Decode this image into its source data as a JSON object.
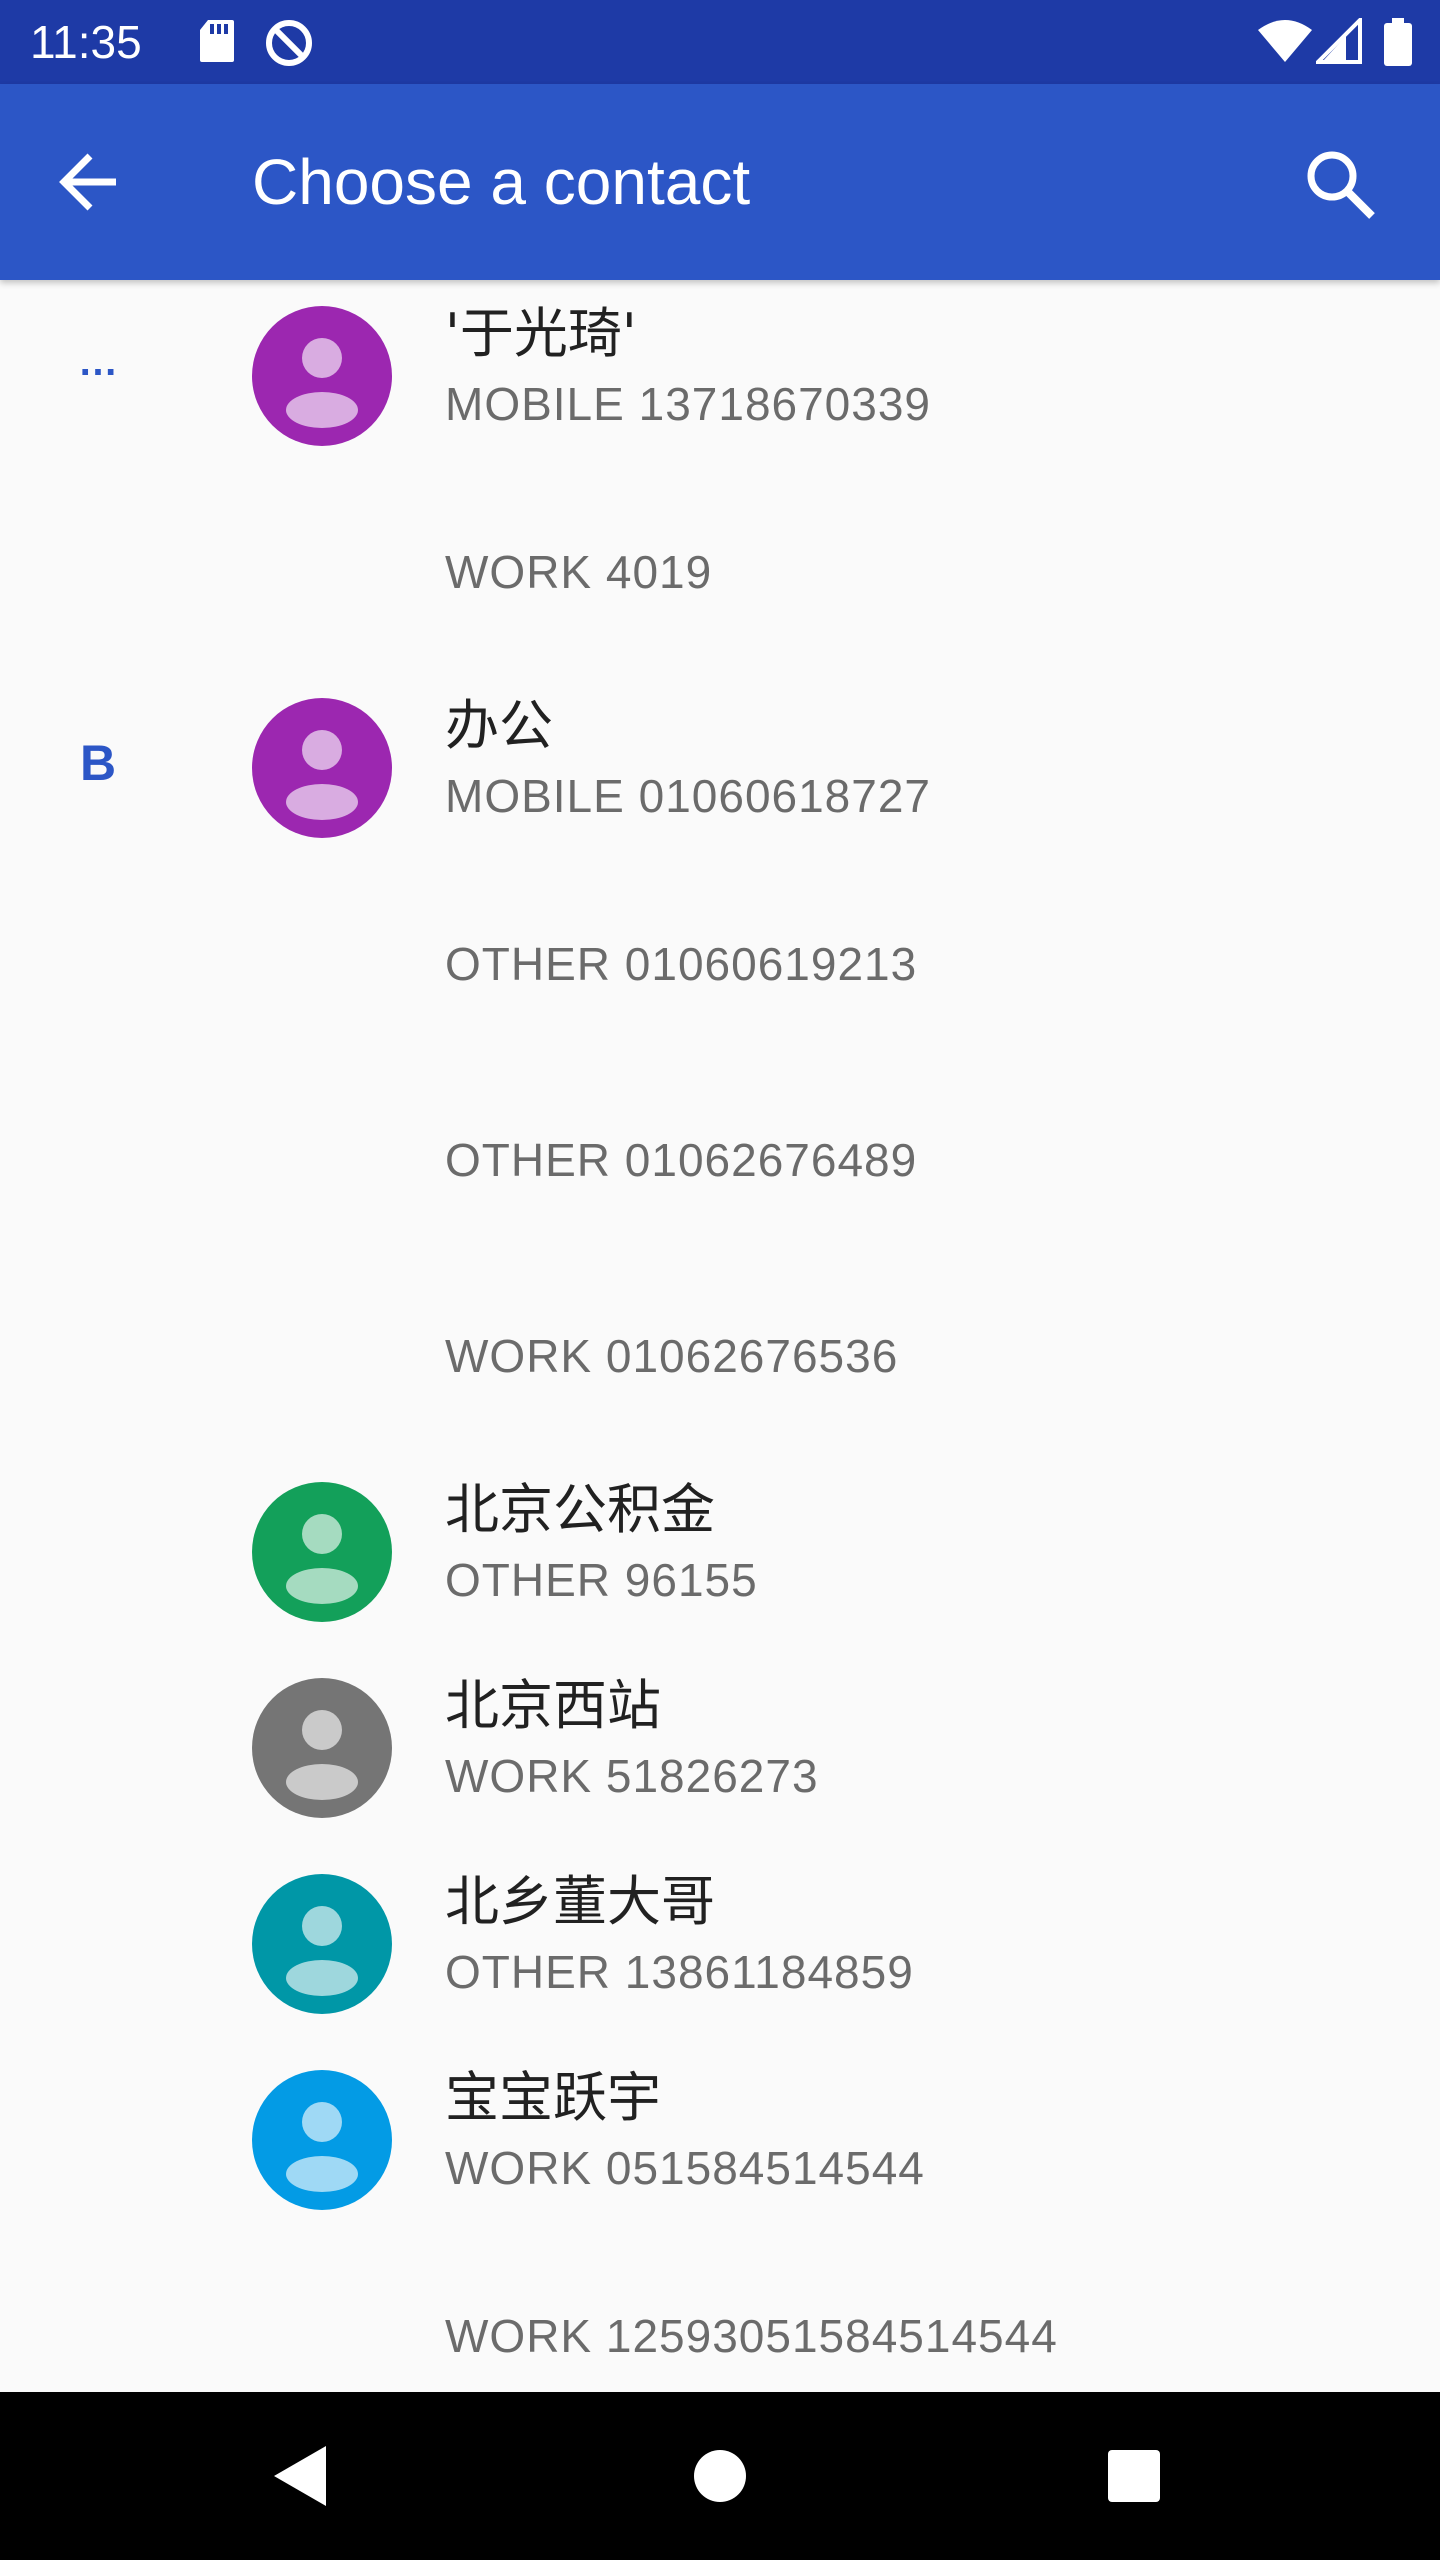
{
  "status_bar": {
    "time": "11:35",
    "icons_left": [
      "sd-card-icon",
      "do-not-disturb-icon"
    ],
    "icons_right": [
      "wifi-icon",
      "signal-icon",
      "battery-icon"
    ]
  },
  "app_bar": {
    "title": "Choose a contact",
    "back_icon": "arrow-back-icon",
    "search_icon": "search-icon"
  },
  "colors": {
    "status_bar": "#1e3aa6",
    "app_bar": "#2c56c6",
    "accent": "#2c56c6",
    "avatar_purple": "#9c27b0",
    "avatar_green": "#13a05a",
    "avatar_gray": "#757575",
    "avatar_teal": "#0097a7",
    "avatar_blue": "#039be5"
  },
  "contacts": {
    "c1": {
      "section": "…",
      "name": "'于光琦'",
      "phone": "MOBILE 13718670339"
    },
    "c1_p2": {
      "phone": "WORK 4019"
    },
    "c2": {
      "section": "B",
      "name": "办公",
      "phone": "MOBILE 01060618727"
    },
    "c2_p2": {
      "phone": "OTHER 01060619213"
    },
    "c2_p3": {
      "phone": "OTHER 01062676489"
    },
    "c2_p4": {
      "phone": "WORK 01062676536"
    },
    "c3": {
      "name": "北京公积金",
      "phone": "OTHER 96155"
    },
    "c4": {
      "name": "北京西站",
      "phone": "WORK 51826273"
    },
    "c5": {
      "name": "北乡董大哥",
      "phone": "OTHER 13861184859"
    },
    "c6": {
      "name": "宝宝跃宇",
      "phone": "WORK 051584514544"
    },
    "c6_p2": {
      "phone": "WORK 12593051584514544"
    }
  },
  "nav_bar": {
    "back_icon": "nav-back-icon",
    "home_icon": "nav-home-icon",
    "recents_icon": "nav-recents-icon"
  }
}
